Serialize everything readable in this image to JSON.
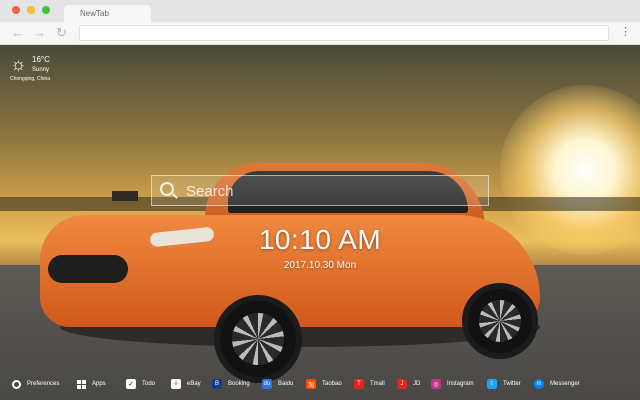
{
  "browser": {
    "tab_title": "NewTab",
    "back_glyph": "←",
    "forward_glyph": "→",
    "reload_glyph": "↻",
    "menu_glyph": "⋮"
  },
  "weather": {
    "icon": "sun-icon",
    "glyph": "☼",
    "temperature": "16°C",
    "condition": "Sunny",
    "location": "Chongqing, China"
  },
  "search": {
    "placeholder": "Search"
  },
  "clock": {
    "time": "10:10 AM",
    "date": "2017.10.30 Mon"
  },
  "bottom_bar": {
    "preferences": "Preferences",
    "apps": "Apps",
    "todo": "Todo",
    "todo_glyph": "✓",
    "links": [
      {
        "label": "eBay",
        "glyph": "e",
        "color": "#ffffff"
      },
      {
        "label": "Booking",
        "glyph": "B",
        "color": "#1a3a8c"
      },
      {
        "label": "Baidu",
        "glyph": "du",
        "color": "#2d74e7"
      },
      {
        "label": "Taobao",
        "glyph": "淘",
        "color": "#ff5000"
      },
      {
        "label": "Tmall",
        "glyph": "T",
        "color": "#e1251b"
      },
      {
        "label": "JD",
        "glyph": "J",
        "color": "#e1251b"
      },
      {
        "label": "Instagram",
        "glyph": "◎",
        "color": "#c13584"
      },
      {
        "label": "Twitter",
        "glyph": "t",
        "color": "#1da1f2"
      },
      {
        "label": "Messenger",
        "glyph": "m",
        "color": "#0084ff"
      }
    ]
  }
}
